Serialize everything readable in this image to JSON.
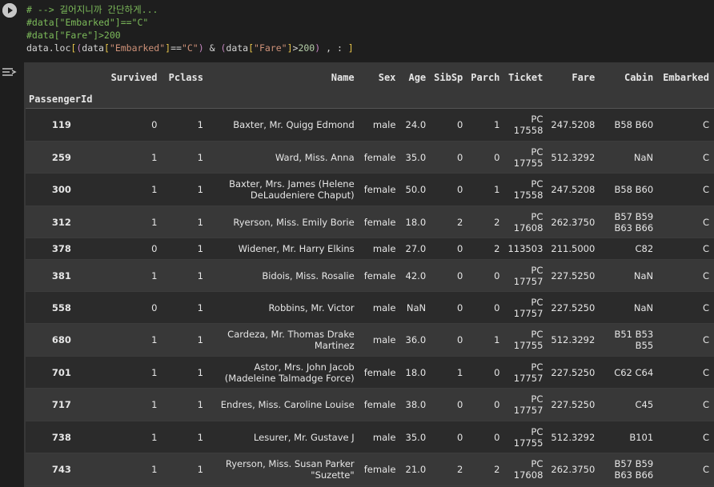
{
  "code": {
    "line1": "# --> 길어지니까 간단하게...",
    "line2": "#data[\"Embarked\"]==\"C\"",
    "line3": "#data[\"Fare\"]>200",
    "line4_parts": {
      "a": "data.loc",
      "b": "[",
      "c": "(",
      "d": "data",
      "e": "[",
      "f": "\"Embarked\"",
      "g": "]",
      "h": "==",
      "i": "\"C\"",
      "j": ")",
      "k": " & ",
      "l": "(",
      "m": "data",
      "n": "[",
      "o": "\"Fare\"",
      "p": "]",
      "q": ">",
      "r": "200",
      "s": ")",
      "t": " , : ",
      "u": "]"
    }
  },
  "icons": {
    "run": "play-circle-icon",
    "output": "output-settings-icon"
  },
  "table": {
    "columns": [
      "Survived",
      "Pclass",
      "Name",
      "Sex",
      "Age",
      "SibSp",
      "Parch",
      "Ticket",
      "Fare",
      "Cabin",
      "Embarked"
    ],
    "index_name": "PassengerId",
    "rows": [
      {
        "id": "119",
        "Survived": "0",
        "Pclass": "1",
        "Name": "Baxter, Mr. Quigg Edmond",
        "Sex": "male",
        "Age": "24.0",
        "SibSp": "0",
        "Parch": "1",
        "Ticket": "PC 17558",
        "Fare": "247.5208",
        "Cabin": "B58 B60",
        "Embarked": "C"
      },
      {
        "id": "259",
        "Survived": "1",
        "Pclass": "1",
        "Name": "Ward, Miss. Anna",
        "Sex": "female",
        "Age": "35.0",
        "SibSp": "0",
        "Parch": "0",
        "Ticket": "PC 17755",
        "Fare": "512.3292",
        "Cabin": "NaN",
        "Embarked": "C"
      },
      {
        "id": "300",
        "Survived": "1",
        "Pclass": "1",
        "Name": "Baxter, Mrs. James (Helene DeLaudeniere Chaput)",
        "Sex": "female",
        "Age": "50.0",
        "SibSp": "0",
        "Parch": "1",
        "Ticket": "PC 17558",
        "Fare": "247.5208",
        "Cabin": "B58 B60",
        "Embarked": "C"
      },
      {
        "id": "312",
        "Survived": "1",
        "Pclass": "1",
        "Name": "Ryerson, Miss. Emily Borie",
        "Sex": "female",
        "Age": "18.0",
        "SibSp": "2",
        "Parch": "2",
        "Ticket": "PC 17608",
        "Fare": "262.3750",
        "Cabin": "B57 B59 B63 B66",
        "Embarked": "C"
      },
      {
        "id": "378",
        "Survived": "0",
        "Pclass": "1",
        "Name": "Widener, Mr. Harry Elkins",
        "Sex": "male",
        "Age": "27.0",
        "SibSp": "0",
        "Parch": "2",
        "Ticket": "113503",
        "Fare": "211.5000",
        "Cabin": "C82",
        "Embarked": "C"
      },
      {
        "id": "381",
        "Survived": "1",
        "Pclass": "1",
        "Name": "Bidois, Miss. Rosalie",
        "Sex": "female",
        "Age": "42.0",
        "SibSp": "0",
        "Parch": "0",
        "Ticket": "PC 17757",
        "Fare": "227.5250",
        "Cabin": "NaN",
        "Embarked": "C"
      },
      {
        "id": "558",
        "Survived": "0",
        "Pclass": "1",
        "Name": "Robbins, Mr. Victor",
        "Sex": "male",
        "Age": "NaN",
        "SibSp": "0",
        "Parch": "0",
        "Ticket": "PC 17757",
        "Fare": "227.5250",
        "Cabin": "NaN",
        "Embarked": "C"
      },
      {
        "id": "680",
        "Survived": "1",
        "Pclass": "1",
        "Name": "Cardeza, Mr. Thomas Drake Martinez",
        "Sex": "male",
        "Age": "36.0",
        "SibSp": "0",
        "Parch": "1",
        "Ticket": "PC 17755",
        "Fare": "512.3292",
        "Cabin": "B51 B53 B55",
        "Embarked": "C"
      },
      {
        "id": "701",
        "Survived": "1",
        "Pclass": "1",
        "Name": "Astor, Mrs. John Jacob (Madeleine Talmadge Force)",
        "Sex": "female",
        "Age": "18.0",
        "SibSp": "1",
        "Parch": "0",
        "Ticket": "PC 17757",
        "Fare": "227.5250",
        "Cabin": "C62 C64",
        "Embarked": "C"
      },
      {
        "id": "717",
        "Survived": "1",
        "Pclass": "1",
        "Name": "Endres, Miss. Caroline Louise",
        "Sex": "female",
        "Age": "38.0",
        "SibSp": "0",
        "Parch": "0",
        "Ticket": "PC 17757",
        "Fare": "227.5250",
        "Cabin": "C45",
        "Embarked": "C"
      },
      {
        "id": "738",
        "Survived": "1",
        "Pclass": "1",
        "Name": "Lesurer, Mr. Gustave J",
        "Sex": "male",
        "Age": "35.0",
        "SibSp": "0",
        "Parch": "0",
        "Ticket": "PC 17755",
        "Fare": "512.3292",
        "Cabin": "B101",
        "Embarked": "C"
      },
      {
        "id": "743",
        "Survived": "1",
        "Pclass": "1",
        "Name": "Ryerson, Miss. Susan Parker \"Suzette\"",
        "Sex": "female",
        "Age": "21.0",
        "SibSp": "2",
        "Parch": "2",
        "Ticket": "PC 17608",
        "Fare": "262.3750",
        "Cabin": "B57 B59 B63 B66",
        "Embarked": "C"
      }
    ]
  }
}
